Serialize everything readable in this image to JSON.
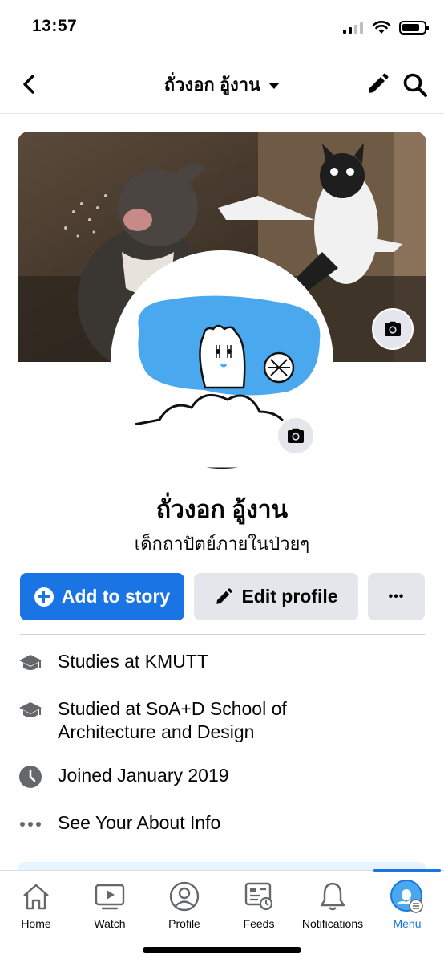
{
  "status_bar": {
    "time": "13:57"
  },
  "header": {
    "title": "ถั่วงอก อู้งาน"
  },
  "profile": {
    "name": "ถั่วงอก อู้งาน",
    "bio": "เด็กถาปัตย์ภายในป่วยๆ"
  },
  "actions": {
    "add_story": "Add to story",
    "edit_profile": "Edit profile",
    "more": "•••"
  },
  "details": {
    "studies_prefix": "Studies at ",
    "studies_school": "KMUTT",
    "studied_prefix": "Studied at ",
    "studied_school_line1": "SoA+D School of",
    "studied_school_line2": "Architecture and Design",
    "joined": "Joined January 2019",
    "about": "See Your About Info"
  },
  "tabs": [
    {
      "label": "Home",
      "icon": "home-icon"
    },
    {
      "label": "Watch",
      "icon": "watch-icon"
    },
    {
      "label": "Profile",
      "icon": "profile-icon"
    },
    {
      "label": "Feeds",
      "icon": "feeds-icon"
    },
    {
      "label": "Notifications",
      "icon": "bell-icon"
    },
    {
      "label": "Menu",
      "icon": "menu-avatar-icon",
      "active": true
    }
  ],
  "colors": {
    "accent": "#1b74e4",
    "button_gray": "#e4e6eb",
    "avatar_blue": "#4aa8ef"
  }
}
